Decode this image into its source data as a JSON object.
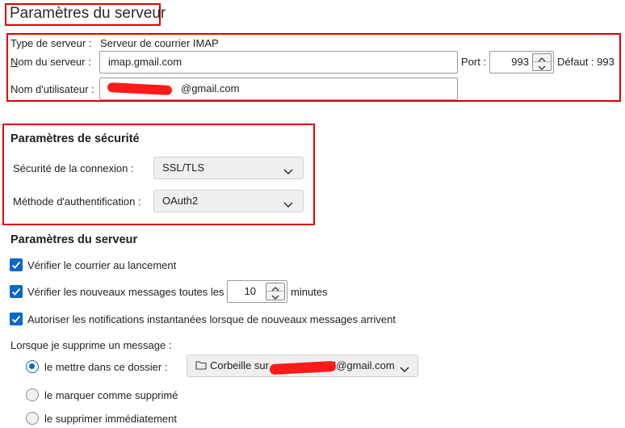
{
  "header": {
    "title": "Paramètres du serveur"
  },
  "server": {
    "type_label": "Type de serveur :",
    "type_value": "Serveur de courrier IMAP",
    "name_label": "Nom du serveur :",
    "name_value": "imap.gmail.com",
    "port_label": "Port :",
    "port_value": "993",
    "default_label": "Défaut : 993",
    "user_label": "Nom d'utilisateur :",
    "user_value_visible": "@gmail.com"
  },
  "security": {
    "heading": "Paramètres de sécurité",
    "connection_label": "Sécurité de la connexion :",
    "connection_value": "SSL/TLS",
    "auth_label": "Méthode d'authentification :",
    "auth_value": "OAuth2"
  },
  "server_settings": {
    "heading": "Paramètres du serveur",
    "check_startup": "Vérifier le courrier au lancement",
    "check_every_prefix": "Vérifier les nouveaux messages toutes les",
    "check_every_value": "10",
    "check_every_suffix": "minutes",
    "push_notifications": "Autoriser les notifications instantanées lorsque de nouveaux messages arrivent",
    "delete_heading": "Lorsque je supprime un message :",
    "delete_option_move": "le mettre dans ce dossier :",
    "folder_value_prefix": "Corbeille sur",
    "folder_value_suffix": "7@gmail.com",
    "delete_option_mark": "le marquer comme supprimé",
    "delete_option_now": "le supprimer immédiatement"
  },
  "colors": {
    "highlight_box": "#e00000",
    "accent": "#0a66c8"
  }
}
